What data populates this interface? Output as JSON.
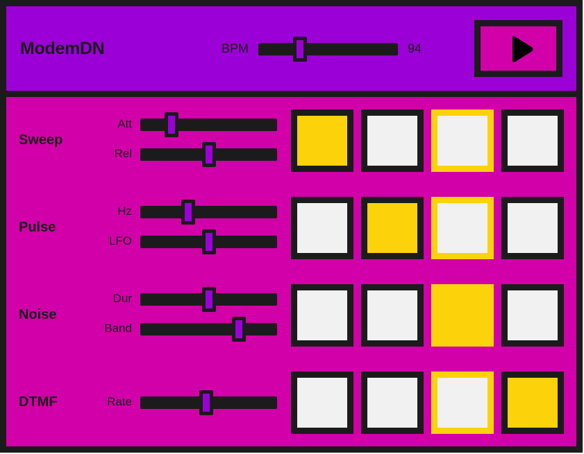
{
  "app": {
    "title": "ModemDN"
  },
  "colors": {
    "frame": "#1b1b1b",
    "header": "#9b00d6",
    "body": "#d200a8",
    "active": "#fcd20a",
    "inactive": "#f1f1f1"
  },
  "transport": {
    "bpm_label": "BPM",
    "bpm_value": "94",
    "bpm_position": 0.3,
    "play_icon": "play-icon",
    "current_step": 3
  },
  "rows": [
    {
      "name": "Sweep",
      "params": [
        {
          "label": "Att",
          "value": 0.23
        },
        {
          "label": "Rel",
          "value": 0.5
        }
      ],
      "steps": [
        true,
        false,
        false,
        false
      ]
    },
    {
      "name": "Pulse",
      "params": [
        {
          "label": "Hz",
          "value": 0.35
        },
        {
          "label": "LFO",
          "value": 0.5
        }
      ],
      "steps": [
        false,
        true,
        false,
        false
      ]
    },
    {
      "name": "Noise",
      "params": [
        {
          "label": "Dur",
          "value": 0.5
        },
        {
          "label": "Band",
          "value": 0.72
        }
      ],
      "steps": [
        false,
        false,
        true,
        false
      ]
    },
    {
      "name": "DTMF",
      "params": [
        {
          "label": "Rate",
          "value": 0.48
        }
      ],
      "steps": [
        false,
        false,
        false,
        true
      ]
    }
  ]
}
